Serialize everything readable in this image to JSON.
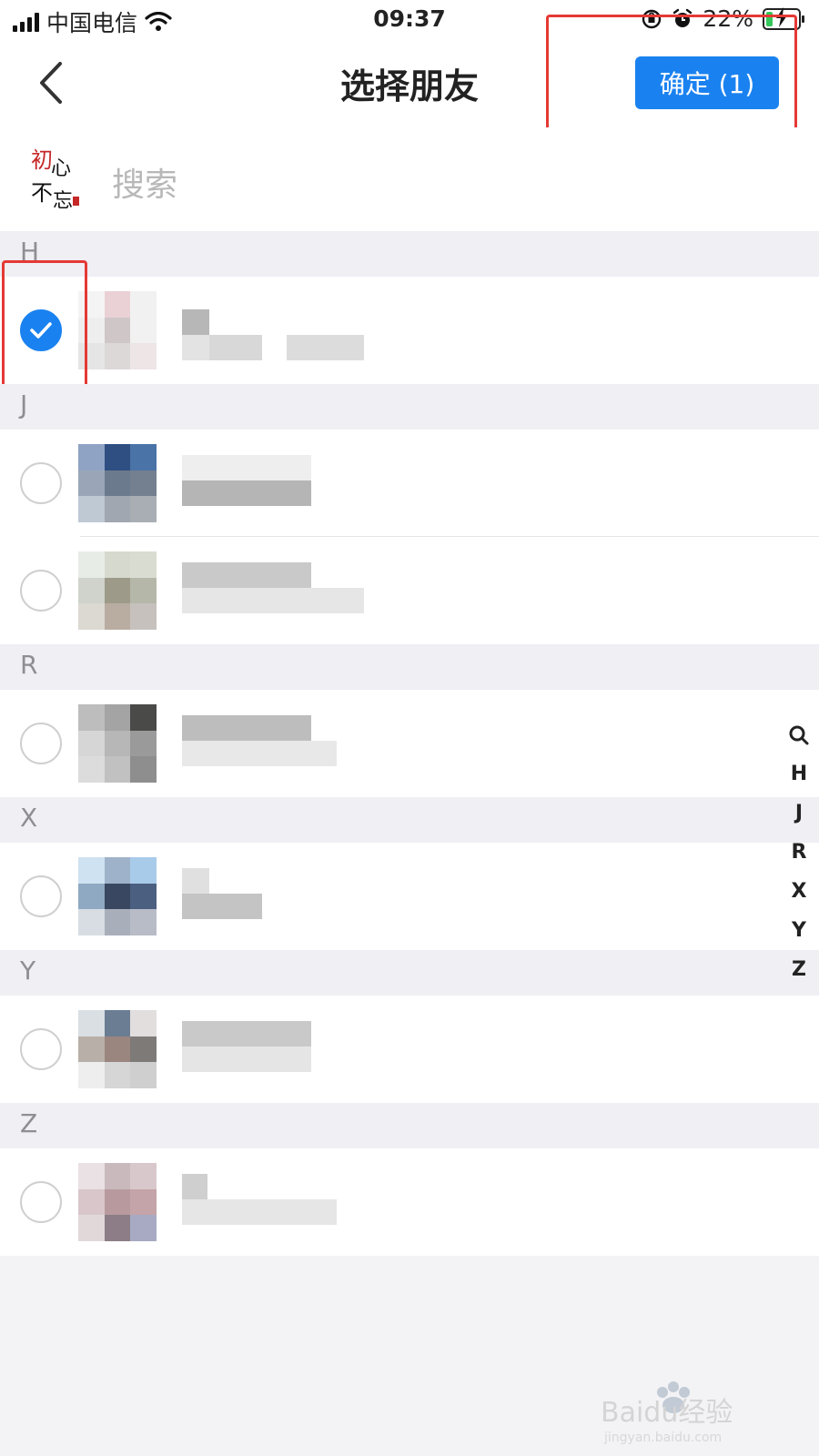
{
  "status_bar": {
    "carrier": "中国电信",
    "time": "09:37",
    "battery": "22%"
  },
  "nav": {
    "title": "选择朋友",
    "confirm_label": "确定 (1)"
  },
  "search": {
    "placeholder": "搜索",
    "logo_glyphs": "初心不忘"
  },
  "sections": [
    {
      "letter": "H"
    },
    {
      "letter": "J"
    },
    {
      "letter": "R"
    },
    {
      "letter": "X"
    },
    {
      "letter": "Y"
    },
    {
      "letter": "Z"
    }
  ],
  "contacts": [
    {
      "section": "H",
      "selected": true
    },
    {
      "section": "J",
      "selected": false
    },
    {
      "section": "J",
      "selected": false
    },
    {
      "section": "R",
      "selected": false
    },
    {
      "section": "X",
      "selected": false
    },
    {
      "section": "Y",
      "selected": false
    },
    {
      "section": "Z",
      "selected": false
    }
  ],
  "index_bar": [
    "Q",
    "H",
    "J",
    "R",
    "X",
    "Y",
    "Z"
  ],
  "watermark": {
    "brand": "Baidu经验",
    "url": "jingyan.baidu.com"
  },
  "colors": {
    "accent": "#1a82f0",
    "annotation": "#e53935"
  }
}
